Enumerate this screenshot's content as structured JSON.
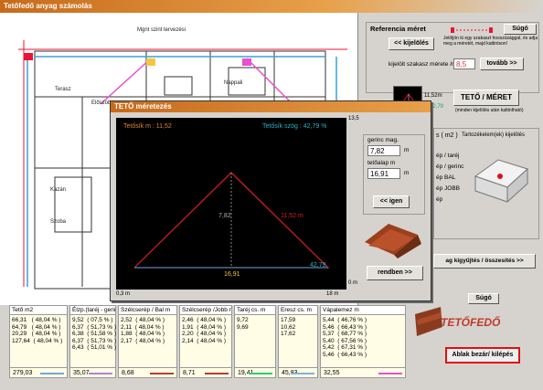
{
  "window": {
    "title": "Tetőfedő anyag számolás"
  },
  "reference": {
    "title": "Referencia méret",
    "help_button": "Súgó",
    "back_button": "<< kijelölés",
    "instruction": "Jelöljön ki egy szakaszt hosszúsággal, és adja meg a méretét, majd kattintson!",
    "measure_label": "kijelölt szakasz mérete /m :",
    "measure_value": "8,5",
    "next_button": "tovább >>"
  },
  "roof": {
    "button": "TETŐ / MÉRET",
    "hint": "(minden kijelölés után kattintható)",
    "mini_values": [
      "11,52m",
      "42,79"
    ]
  },
  "right_panel": {
    "section_label": "s ( m2 )",
    "components_label": "Tartozékelem(ek) kijelölés",
    "items": [
      "ép / taréj",
      "ép / gerinc",
      "ép BAL",
      "ép JOBB",
      "ép"
    ],
    "collect_button": "ag kigyűjtés / összesítés >>",
    "help_button": "Súgó",
    "logo_text": "TETŐFEDŐ",
    "exit_button": "Ablak bezár/ kilépés"
  },
  "dialog": {
    "title": "TETŐ méretezés",
    "roof_length_label": "Tetősík m : 11,52",
    "roof_angle_label": "Tetősík szög : 42,79 %",
    "ridge_height_label": "gerinc mag.",
    "ridge_height_value": "7,82",
    "ridge_height_unit": "m",
    "base_width_label": "tetőalap m",
    "base_width_value": "16,91",
    "base_width_unit": "m",
    "ok_button": "<< igen",
    "confirm_button": "rendben >>",
    "axis_top": "13,5",
    "axis_bottom": "0 m",
    "axis_left": "0,3 m",
    "axis_right": "18 m",
    "label_height": "7,82",
    "label_slope": "11,52 m",
    "label_base": "16,91",
    "label_angle": "42,79"
  },
  "columns": [
    {
      "header": "Tető m2",
      "rows": [
        "66,31   ( 48,04 % )",
        "64,79   ( 48,04 % )",
        "20,29   ( 48,04 % )",
        "127,64  ( 48,04 % )"
      ],
      "total": "279,03",
      "color": "#6fa8dc"
    },
    {
      "header": "Élzp.(taréj - gerinc /m)",
      "rows": [
        "9,52  ( 07,5 % )",
        "6,37  ( 51,73 % )",
        "6,38  ( 51,58 % )",
        "6,37  ( 51,73 % )",
        "6,43  ( 51,01 % )"
      ],
      "total": "35,07",
      "color": "#b77fd6"
    },
    {
      "header": "Szélcserép / Bal m",
      "rows": [
        "2,52  ( 48,04 % )",
        "2,11  ( 48,04 % )",
        "1,88  ( 48,04 % )",
        "2,17  ( 48,04 % )"
      ],
      "total": "8,68",
      "color": "#c0392b"
    },
    {
      "header": "Szélcserép /Jobb m",
      "rows": [
        "2,46  ( 48,04 % )",
        "1,91  ( 48,04 % )",
        "2,20  ( 48,04 % )",
        "2,14  ( 48,04 % )"
      ],
      "total": "8,71",
      "color": "#c0392b"
    },
    {
      "header": "Taréj cs. m",
      "rows": [
        "9,72",
        "9,69"
      ],
      "total": "19,41",
      "color": "#2ecc71"
    },
    {
      "header": "Eresz cs. m",
      "rows": [
        "17,59",
        "10,62",
        "17,62"
      ],
      "total": "45,83",
      "color": "#7fb3d5"
    },
    {
      "header": "Vápalemez m",
      "rows": [
        "5,44  ( 46,76 % )",
        "5,46  ( 66,43 % )",
        "5,37  ( 68,77 % )",
        "5,40  ( 67,56 % )",
        "5,42  ( 67,31 % )",
        "5,46  ( 66,43 % )"
      ],
      "total": "32,55",
      "color": "#e84fd1"
    }
  ]
}
